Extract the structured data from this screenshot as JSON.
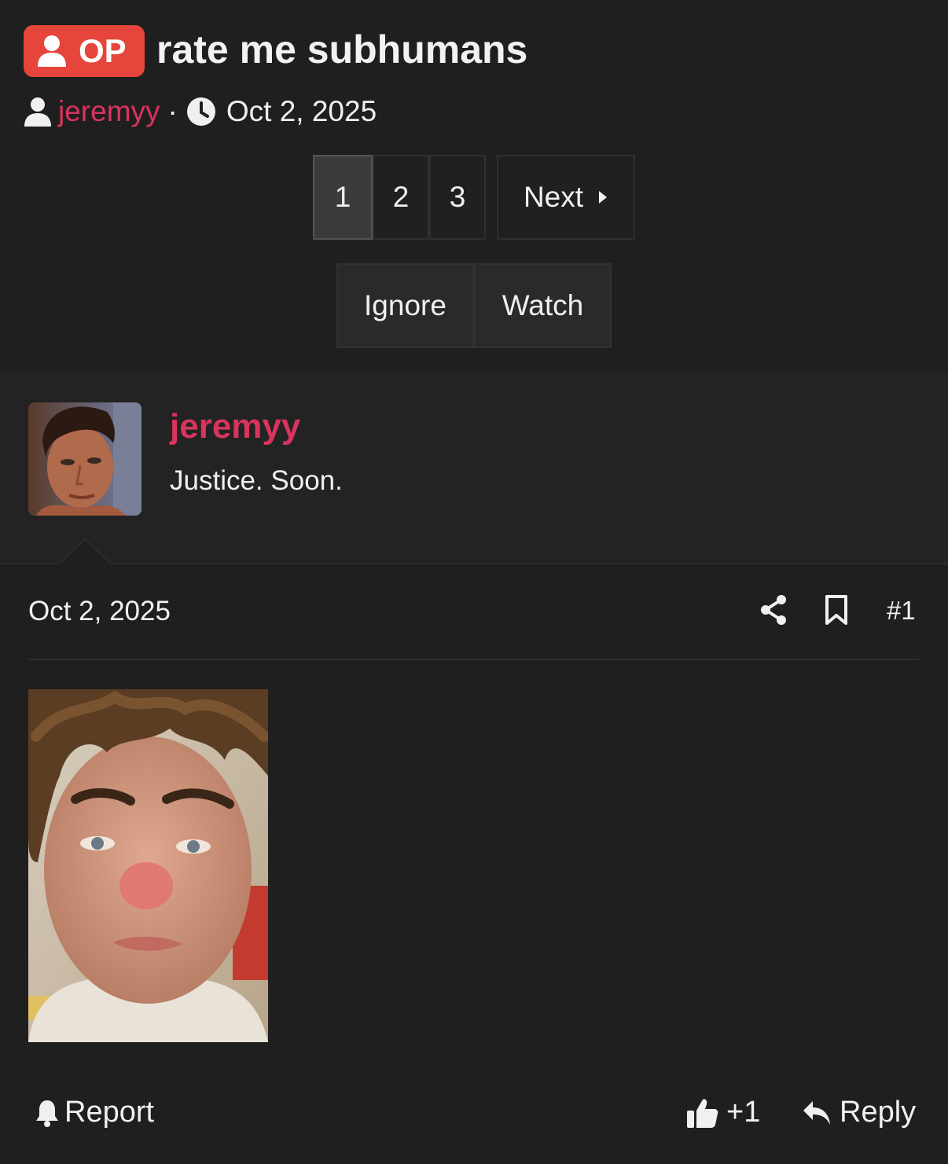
{
  "thread": {
    "badge_label": "OP",
    "title": "rate me subhumans",
    "author": "jeremyy",
    "separator": "·",
    "date": "Oct 2, 2025"
  },
  "pagination": {
    "pages": [
      "1",
      "2",
      "3"
    ],
    "current": "1",
    "next_label": "Next"
  },
  "thread_actions": {
    "ignore_label": "Ignore",
    "watch_label": "Watch"
  },
  "post": {
    "username": "jeremyy",
    "user_title": "Justice. Soon.",
    "date": "Oct 2, 2025",
    "number": "#1",
    "report_label": "Report",
    "like_count": "+1",
    "reply_label": "Reply"
  },
  "colors": {
    "accent": "#d9345d",
    "op_badge": "#e5453b",
    "background": "#1f1f1f"
  },
  "icons": [
    "user-icon",
    "clock-icon",
    "caret-right-icon",
    "share-icon",
    "bookmark-icon",
    "bell-icon",
    "thumbs-up-icon",
    "reply-icon"
  ]
}
